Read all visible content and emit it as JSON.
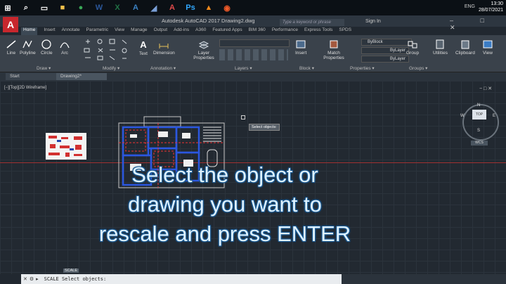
{
  "taskbar": {
    "icons": [
      {
        "name": "windows-start-icon",
        "glyph": "⊞",
        "color": "#ffffff"
      },
      {
        "name": "search-icon",
        "glyph": "⌕",
        "color": "#ffffff"
      },
      {
        "name": "task-view-icon",
        "glyph": "▭",
        "color": "#ffffff"
      },
      {
        "name": "file-explorer-icon",
        "glyph": "■",
        "color": "#f3c14b"
      },
      {
        "name": "chrome-icon",
        "glyph": "●",
        "color": "#3aa757"
      },
      {
        "name": "word-icon",
        "glyph": "W",
        "color": "#2b579a"
      },
      {
        "name": "excel-icon",
        "glyph": "X",
        "color": "#217346"
      },
      {
        "name": "autocad-app-icon",
        "glyph": "A",
        "color": "#3b82c4"
      },
      {
        "name": "app-icon",
        "glyph": "◢",
        "color": "#7aa0d8"
      },
      {
        "name": "autocad-active-icon",
        "glyph": "A",
        "color": "#e34b4b"
      },
      {
        "name": "photoshop-icon",
        "glyph": "Ps",
        "color": "#31a8ff"
      },
      {
        "name": "vlc-icon",
        "glyph": "▲",
        "color": "#f08a1c"
      },
      {
        "name": "record-icon",
        "glyph": "◉",
        "color": "#f05a28"
      }
    ],
    "tray": "ENG",
    "time": "13:30",
    "date": "28/07/2021"
  },
  "title": {
    "text": "Autodesk AutoCAD 2017    Drawing2.dwg",
    "search_placeholder": "Type a keyword or phrase",
    "sign_in": "Sign In",
    "controls": "–  □  ✕"
  },
  "menu": [
    "Home",
    "Insert",
    "Annotate",
    "Parametric",
    "View",
    "Manage",
    "Output",
    "Add-ins",
    "A360",
    "Featured Apps",
    "BIM 360",
    "Performance",
    "Express Tools",
    "SPDS"
  ],
  "ribbon": {
    "draw_tools": [
      "Line",
      "Polyline",
      "Circle",
      "Arc"
    ],
    "text_label": "Text",
    "dimension_label": "Dimension",
    "layer_props": "Layer Properties",
    "insert_label": "Insert",
    "match_props": "Match Properties",
    "byblock": "ByBlock",
    "bylayer": "ByLayer",
    "group": "Group",
    "utilities": "Utilities",
    "clipboard": "Clipboard",
    "view": "View",
    "panels": [
      "Draw ▾",
      "Modify ▾",
      "Annotation ▾",
      "Layers ▾",
      "Block ▾",
      "Properties ▾",
      "Groups ▾"
    ]
  },
  "file_tabs": [
    "Start",
    "Drawing2*"
  ],
  "viewport": {
    "label": "[−][Top][2D Wireframe]",
    "tooltip": "Select objects:",
    "viewcube_top": "TOP",
    "wcs": "WCS",
    "compass": {
      "n": "N",
      "s": "S",
      "e": "E",
      "w": "W"
    }
  },
  "overlay": {
    "line1": "Select the object or",
    "line2": "drawing you want to",
    "line3": "rescale and press ENTER"
  },
  "command": {
    "tag": "SCALE",
    "text": "SCALE Select objects:"
  },
  "colors": {
    "autocad_red": "#c8272d",
    "ribbon_bg": "#3a424b",
    "viewport_bg": "#222931"
  }
}
